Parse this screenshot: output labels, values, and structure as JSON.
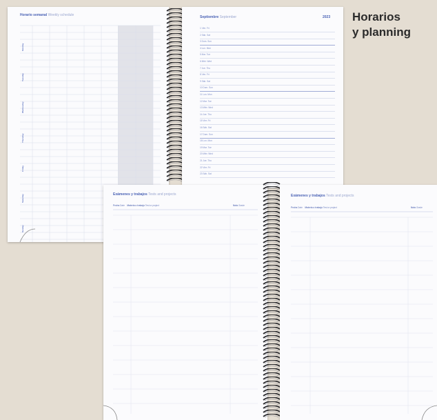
{
  "caption": {
    "line1": "Horarios",
    "line2": "y planning"
  },
  "notebook_back": {
    "left_page": {
      "title": "Horario semanal",
      "subtitle": "Weekly schedule",
      "day_labels": [
        "Monday",
        "Tuesday",
        "Wednesday",
        "Thursday",
        "Friday",
        "Saturday",
        "Sunday"
      ]
    },
    "right_page": {
      "title": "Septiembre",
      "subtitle": "September",
      "year": "2023",
      "days": [
        "1 Vier. Fri",
        "2 Sáb. Sat",
        "3 Dom. Sun",
        "4 Lun. Mon",
        "5 Mar. Tue",
        "6 Miér. Wed",
        "7 Jue. Thu",
        "8 Vier. Fri",
        "9 Sáb. Sat",
        "10 Dom. Sun",
        "11 Lun. Mon",
        "12 Mar. Tue",
        "13 Miér. Wed",
        "14 Jue. Thu",
        "15 Vier. Fri",
        "16 Sáb. Sat",
        "17 Dom. Sun",
        "18 Lun. Mon",
        "19 Mar. Tue",
        "20 Miér. Wed",
        "21 Jue. Thu",
        "22 Vier. Fri",
        "23 Sáb. Sat"
      ]
    }
  },
  "notebook_front": {
    "left_page": {
      "title": "Exámenes y trabajos",
      "subtitle": "Tests and projects",
      "field_date": "Fecha",
      "field_date_en": "Date",
      "field_subject": "Materia o trabajo",
      "field_subject_en": "Test or project",
      "field_mark": "Nota",
      "field_mark_en": "Grade"
    },
    "right_page": {
      "title": "Exámenes y trabajos",
      "subtitle": "Tests and projects",
      "field_date": "Fecha",
      "field_date_en": "Date",
      "field_subject": "Materia o trabajo",
      "field_subject_en": "Test or project",
      "field_mark": "Nota",
      "field_mark_en": "Grade"
    }
  }
}
